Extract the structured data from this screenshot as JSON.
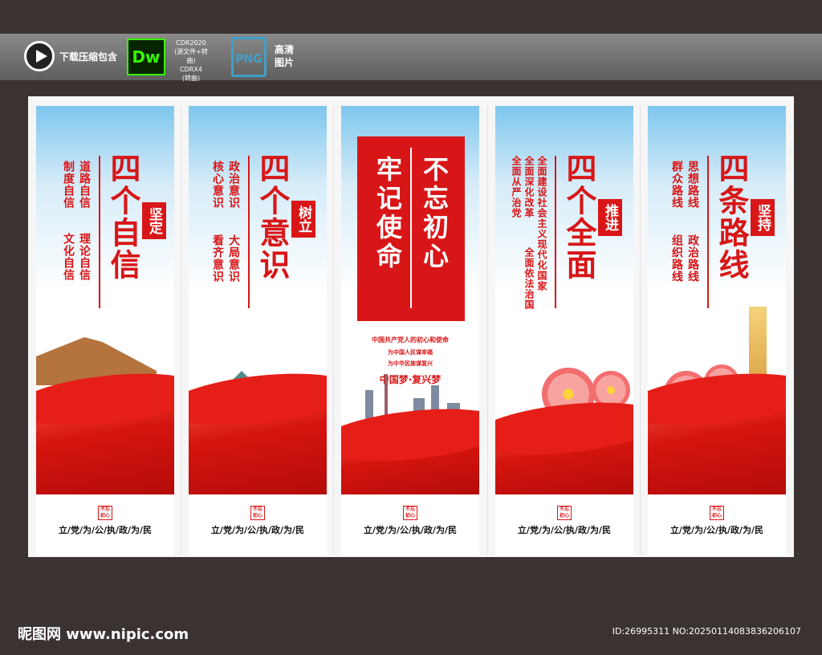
{
  "topbar": {
    "download_label": "下载压缩包含",
    "dw_label": "Dw",
    "format_lines": [
      "CDR2020",
      "(源文件+转曲)",
      "CDRX4",
      "(转曲)"
    ],
    "png_label": "PNG",
    "hd_label": "高清图片"
  },
  "panels": [
    {
      "title": "四个自信",
      "badge": "坚定",
      "subs": [
        "道路自信",
        "制度自信",
        "理论自信",
        "文化自信"
      ],
      "seal": "不忘初心",
      "motto": "立/党/为/公/执/政/为/民"
    },
    {
      "title": "四个意识",
      "badge": "树立",
      "subs": [
        "政治意识",
        "核心意识",
        "大局意识",
        "看齐意识"
      ],
      "seal": "不忘初心",
      "motto": "立/党/为/公/执/政/为/民"
    },
    {
      "title_right": "不忘初心",
      "title_left": "牢记使命",
      "line1": "中国共产党人的初心和使命",
      "line2": "为中国人民谋幸福",
      "line3": "为中华民族谋复兴",
      "line4": "中国梦·复兴梦",
      "seal": "不忘初心",
      "motto": "立/党/为/公/执/政/为/民"
    },
    {
      "title": "四个全面",
      "badge": "推进",
      "subs": [
        "全面建设社会主义现代化国家",
        "全面深化改革",
        "全面依法治国",
        "全面从严治党"
      ],
      "seal": "不忘初心",
      "motto": "立/党/为/公/执/政/为/民"
    },
    {
      "title": "四条路线",
      "badge": "坚持",
      "subs": [
        "思想路线",
        "群众路线",
        "政治路线",
        "组织路线"
      ],
      "seal": "不忘初心",
      "motto": "立/党/为/公/执/政/为/民"
    }
  ],
  "footer": {
    "site": "昵图网 www.nipic.com",
    "id": "ID:26995311 NO:20250114083836206107"
  },
  "colors": {
    "red": "#d81617",
    "bg": "#3a3331",
    "sky": "#7ec6ee"
  }
}
